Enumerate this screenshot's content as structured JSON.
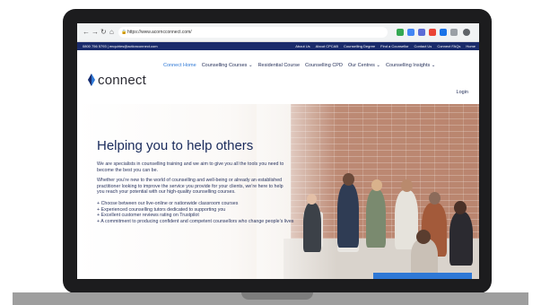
{
  "browser": {
    "url": "https://www.acorncconnect.com/"
  },
  "topbar": {
    "contact": "0800 756 5793 | enquiries@actionconnect.com",
    "links": [
      "About Us",
      "About CPCAB",
      "Counselling Degree",
      "Find a Counsellor",
      "Contact Us",
      "Connect FAQs",
      "Home"
    ]
  },
  "brand": {
    "name": "connect",
    "color": "#1a2b6b",
    "accent": "#2e78d6"
  },
  "nav": {
    "items": [
      "Connect Home",
      "Counselling Courses ⌄",
      "Residential Course",
      "Counselling CPD",
      "Our Centres ⌄",
      "Counselling Insights ⌄"
    ],
    "login": "Login"
  },
  "hero": {
    "title": "Helping you to help others",
    "paragraph1": "We are specialists in counselling training and we aim to give you all the tools you need to become the best you can be.",
    "paragraph2": "Whether you’re new to the world of counselling and well-being or already an established practitioner looking to improve the service you provide for your clients, we’re here to help you reach your potential with our high-quality counselling courses.",
    "bullets": [
      "+ Choose between our live-online or nationwide classroom courses",
      "+ Experienced counselling tutors dedicated to supporting you",
      "+ Excellent customer reviews rating on Trustpilot",
      "+ A commitment to producing confident and competent counsellors who change people’s lives"
    ]
  }
}
